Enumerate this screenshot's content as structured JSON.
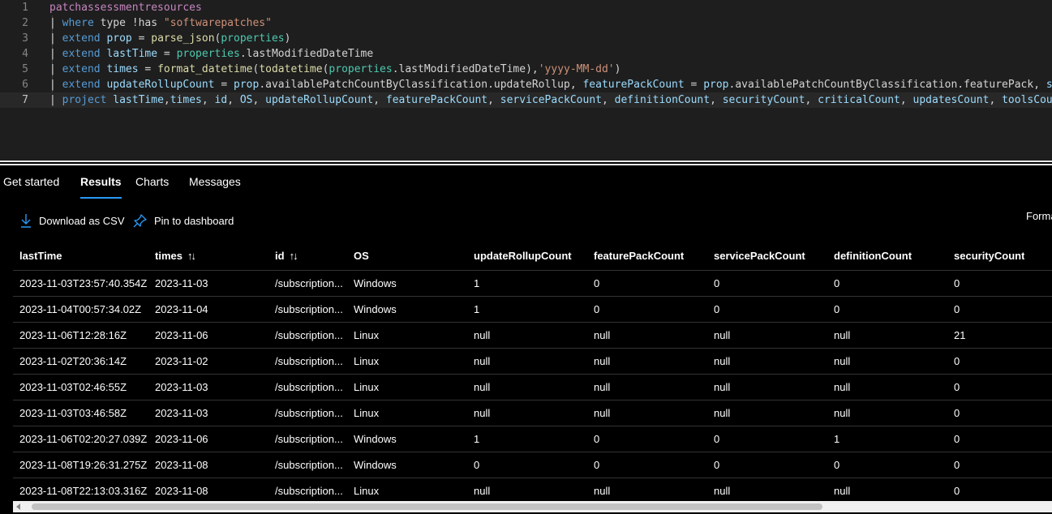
{
  "editor": {
    "lines": [
      {
        "num": "1",
        "tokens": [
          {
            "t": "patchassessmentresources",
            "c": "tbl"
          }
        ]
      },
      {
        "num": "2",
        "tokens": [
          {
            "t": "| ",
            "c": "pipe"
          },
          {
            "t": "where",
            "c": "kw"
          },
          {
            "t": " type !has ",
            "c": "plain"
          },
          {
            "t": "\"softwarepatches\"",
            "c": "str"
          }
        ]
      },
      {
        "num": "3",
        "tokens": [
          {
            "t": "| ",
            "c": "pipe"
          },
          {
            "t": "extend",
            "c": "kw"
          },
          {
            "t": " ",
            "c": "plain"
          },
          {
            "t": "prop",
            "c": "var"
          },
          {
            "t": " = ",
            "c": "plain"
          },
          {
            "t": "parse_json",
            "c": "fn"
          },
          {
            "t": "(",
            "c": "plain"
          },
          {
            "t": "properties",
            "c": "col"
          },
          {
            "t": ")",
            "c": "plain"
          }
        ]
      },
      {
        "num": "4",
        "tokens": [
          {
            "t": "| ",
            "c": "pipe"
          },
          {
            "t": "extend",
            "c": "kw"
          },
          {
            "t": " ",
            "c": "plain"
          },
          {
            "t": "lastTime",
            "c": "var"
          },
          {
            "t": " = ",
            "c": "plain"
          },
          {
            "t": "properties",
            "c": "col"
          },
          {
            "t": ".lastModifiedDateTime",
            "c": "plain"
          }
        ]
      },
      {
        "num": "5",
        "tokens": [
          {
            "t": "| ",
            "c": "pipe"
          },
          {
            "t": "extend",
            "c": "kw"
          },
          {
            "t": " ",
            "c": "plain"
          },
          {
            "t": "times",
            "c": "var"
          },
          {
            "t": " = ",
            "c": "plain"
          },
          {
            "t": "format_datetime",
            "c": "fn"
          },
          {
            "t": "(",
            "c": "plain"
          },
          {
            "t": "todatetime",
            "c": "fn"
          },
          {
            "t": "(",
            "c": "plain"
          },
          {
            "t": "properties",
            "c": "col"
          },
          {
            "t": ".lastModifiedDateTime),",
            "c": "plain"
          },
          {
            "t": "'yyyy-MM-dd'",
            "c": "str"
          },
          {
            "t": ")",
            "c": "plain"
          }
        ]
      },
      {
        "num": "6",
        "tokens": [
          {
            "t": "| ",
            "c": "pipe"
          },
          {
            "t": "extend",
            "c": "kw"
          },
          {
            "t": " ",
            "c": "plain"
          },
          {
            "t": "updateRollupCount",
            "c": "var"
          },
          {
            "t": " = ",
            "c": "plain"
          },
          {
            "t": "prop",
            "c": "var"
          },
          {
            "t": ".availablePatchCountByClassification.updateRollup, ",
            "c": "plain"
          },
          {
            "t": "featurePackCount",
            "c": "var"
          },
          {
            "t": " = ",
            "c": "plain"
          },
          {
            "t": "prop",
            "c": "var"
          },
          {
            "t": ".availablePatchCountByClassification.featurePack, ",
            "c": "plain"
          },
          {
            "t": "serv",
            "c": "var"
          }
        ]
      },
      {
        "num": "7",
        "tokens": [
          {
            "t": "| ",
            "c": "pipe"
          },
          {
            "t": "project",
            "c": "kw"
          },
          {
            "t": " ",
            "c": "plain"
          },
          {
            "t": "lastTime",
            "c": "var"
          },
          {
            "t": ",",
            "c": "plain"
          },
          {
            "t": "times",
            "c": "var"
          },
          {
            "t": ", ",
            "c": "plain"
          },
          {
            "t": "id",
            "c": "var"
          },
          {
            "t": ", ",
            "c": "plain"
          },
          {
            "t": "OS",
            "c": "var"
          },
          {
            "t": ", ",
            "c": "plain"
          },
          {
            "t": "updateRollupCount",
            "c": "var"
          },
          {
            "t": ", ",
            "c": "plain"
          },
          {
            "t": "featurePackCount",
            "c": "var"
          },
          {
            "t": ", ",
            "c": "plain"
          },
          {
            "t": "servicePackCount",
            "c": "var"
          },
          {
            "t": ", ",
            "c": "plain"
          },
          {
            "t": "definitionCount",
            "c": "var"
          },
          {
            "t": ", ",
            "c": "plain"
          },
          {
            "t": "securityCount",
            "c": "var"
          },
          {
            "t": ", ",
            "c": "plain"
          },
          {
            "t": "criticalCount",
            "c": "var"
          },
          {
            "t": ", ",
            "c": "plain"
          },
          {
            "t": "updatesCount",
            "c": "var"
          },
          {
            "t": ", ",
            "c": "plain"
          },
          {
            "t": "toolsCount",
            "c": "var"
          },
          {
            "t": ",",
            "c": "plain"
          }
        ]
      }
    ]
  },
  "tabs": [
    {
      "label": "Get started",
      "active": false
    },
    {
      "label": "Results",
      "active": true
    },
    {
      "label": "Charts",
      "active": false
    },
    {
      "label": "Messages",
      "active": false
    }
  ],
  "toolbar": {
    "download_label": "Download as CSV",
    "pin_label": "Pin to dashboard",
    "format_label": "Forma"
  },
  "table": {
    "columns": [
      {
        "label": "lastTime",
        "sortable": false
      },
      {
        "label": "times",
        "sortable": true
      },
      {
        "label": "id",
        "sortable": true
      },
      {
        "label": "OS",
        "sortable": false
      },
      {
        "label": "updateRollupCount",
        "sortable": false
      },
      {
        "label": "featurePackCount",
        "sortable": false
      },
      {
        "label": "servicePackCount",
        "sortable": false
      },
      {
        "label": "definitionCount",
        "sortable": false
      },
      {
        "label": "securityCount",
        "sortable": false
      }
    ],
    "rows": [
      [
        "2023-11-03T23:57:40.354Z",
        "2023-11-03",
        "/subscription...",
        "Windows",
        "1",
        "0",
        "0",
        "0",
        "0"
      ],
      [
        "2023-11-04T00:57:34.02Z",
        "2023-11-04",
        "/subscription...",
        "Windows",
        "1",
        "0",
        "0",
        "0",
        "0"
      ],
      [
        "2023-11-06T12:28:16Z",
        "2023-11-06",
        "/subscription...",
        "Linux",
        "null",
        "null",
        "null",
        "null",
        "21"
      ],
      [
        "2023-11-02T20:36:14Z",
        "2023-11-02",
        "/subscription...",
        "Linux",
        "null",
        "null",
        "null",
        "null",
        "0"
      ],
      [
        "2023-11-03T02:46:55Z",
        "2023-11-03",
        "/subscription...",
        "Linux",
        "null",
        "null",
        "null",
        "null",
        "0"
      ],
      [
        "2023-11-03T03:46:58Z",
        "2023-11-03",
        "/subscription...",
        "Linux",
        "null",
        "null",
        "null",
        "null",
        "0"
      ],
      [
        "2023-11-06T02:20:27.039Z",
        "2023-11-06",
        "/subscription...",
        "Windows",
        "1",
        "0",
        "0",
        "1",
        "0"
      ],
      [
        "2023-11-08T19:26:31.275Z",
        "2023-11-08",
        "/subscription...",
        "Windows",
        "0",
        "0",
        "0",
        "0",
        "0"
      ],
      [
        "2023-11-08T22:13:03.316Z",
        "2023-11-08",
        "/subscription...",
        "Linux",
        "null",
        "null",
        "null",
        "null",
        "0"
      ]
    ]
  },
  "icons": {
    "download": "download-icon",
    "pin": "pin-icon",
    "sort": "sort-icon"
  },
  "colors": {
    "accent": "#2899f5",
    "keyword": "#569cd6",
    "string": "#ce9178"
  }
}
